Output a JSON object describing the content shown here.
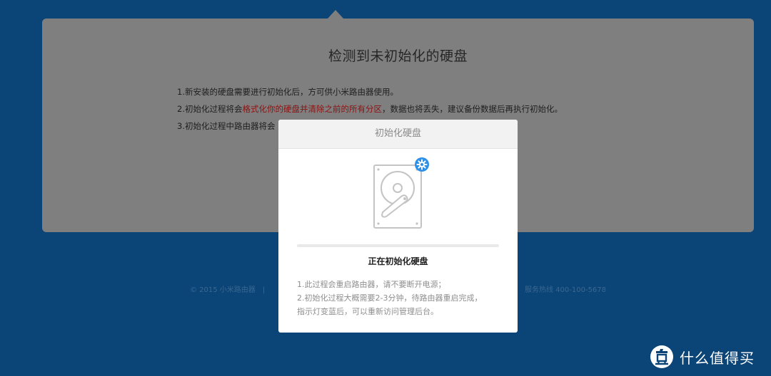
{
  "panel": {
    "title": "检测到未初始化的硬盘",
    "notes": [
      {
        "before": "1.新安装的硬盘需要进行初始化后，方可供小米路由器使用。",
        "warn": "",
        "after": ""
      },
      {
        "before": "2.初始化过程将会",
        "warn": "格式化你的硬盘并清除之前的所有分区",
        "after": "，数据也将丢失，建议备份数据后再执行初始化。"
      },
      {
        "before": "3.初始化过程中路由器将会",
        "warn": "",
        "after": ""
      }
    ]
  },
  "footer": {
    "copyright": "© 2015 小米路由器",
    "separator": "|",
    "hotline": "服务热线 400-100-5678"
  },
  "modal": {
    "title": "初始化硬盘",
    "icon": "hard-disk-icon",
    "badge_icon": "gear-icon",
    "progress": 0,
    "status": "正在初始化硬盘",
    "tips": [
      "1.此过程会重启路由器，请不要断开电源；",
      "2.初始化过程大概需要2-3分钟，待路由器重启完成，",
      "指示灯变蓝后，可以重新访问管理后台。"
    ]
  },
  "watermark": {
    "text": "什么值得买",
    "icon": "zhi-logo-icon"
  },
  "colors": {
    "background": "#0b4476",
    "panel": "#7f7f7f",
    "warning": "#8c1111",
    "accent": "#2c90e8"
  }
}
